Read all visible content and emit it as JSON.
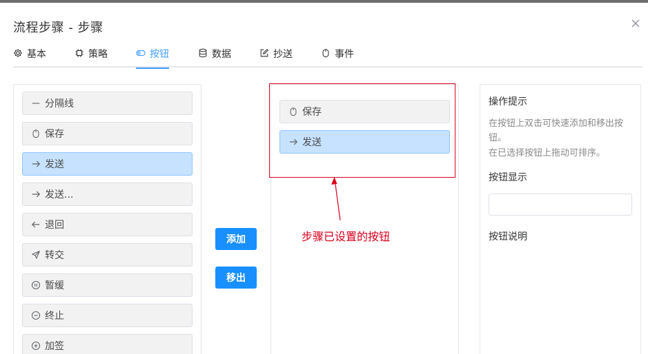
{
  "dialog": {
    "title": "流程步骤 - 步骤"
  },
  "tabs": [
    {
      "label": "基本",
      "icon": "gear-icon"
    },
    {
      "label": "策略",
      "icon": "chip-icon"
    },
    {
      "label": "按钮",
      "icon": "toggle-icon",
      "active": true
    },
    {
      "label": "数据",
      "icon": "database-icon"
    },
    {
      "label": "抄送",
      "icon": "edit-icon"
    },
    {
      "label": "事件",
      "icon": "mouse-icon"
    }
  ],
  "available_buttons": [
    {
      "label": "分隔线",
      "icon": "minus-icon"
    },
    {
      "label": "保存",
      "icon": "mouse-icon"
    },
    {
      "label": "发送",
      "icon": "arrow-right-icon",
      "selected": true
    },
    {
      "label": "发送...",
      "icon": "arrow-right-icon"
    },
    {
      "label": "退回",
      "icon": "arrow-left-icon"
    },
    {
      "label": "转交",
      "icon": "send-icon"
    },
    {
      "label": "暂缓",
      "icon": "pause-icon"
    },
    {
      "label": "终止",
      "icon": "minus-circle-icon"
    },
    {
      "label": "加签",
      "icon": "plus-circle-icon"
    }
  ],
  "actions": {
    "add_label": "添加",
    "remove_label": "移出"
  },
  "configured_buttons": [
    {
      "label": "保存",
      "icon": "mouse-icon"
    },
    {
      "label": "发送",
      "icon": "arrow-right-icon",
      "selected": true
    }
  ],
  "annotation": {
    "text": "步骤已设置的按钮",
    "color": "#d9001b"
  },
  "hints": {
    "title": "操作提示",
    "line1": "在按钮上双击可快速添加和移出按钮。",
    "line2": "在已选择按钮上拖动可排序。"
  },
  "fields": {
    "display_label": "按钮显示",
    "display_value": "",
    "description_label": "按钮说明"
  },
  "colors": {
    "accent": "#409eff",
    "primary_button": "#1890ff",
    "selected_item": "#c6e2ff",
    "annotation": "#d9001b"
  }
}
